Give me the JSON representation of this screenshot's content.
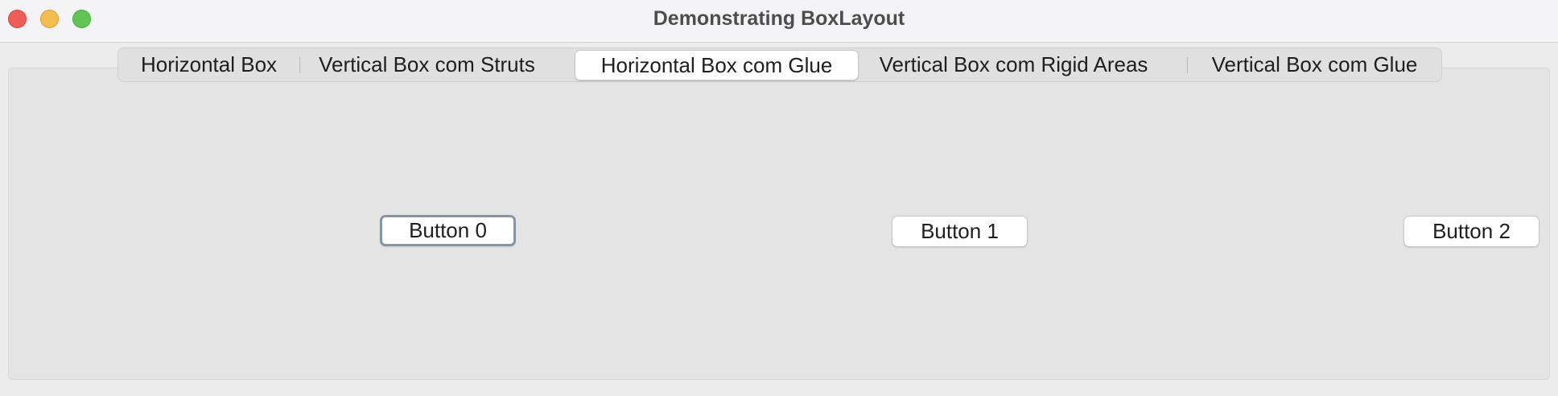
{
  "window": {
    "title": "Demonstrating BoxLayout"
  },
  "tabs": [
    {
      "label": "Horizontal Box",
      "selected": false
    },
    {
      "label": "Vertical Box com Struts",
      "selected": false
    },
    {
      "label": "Horizontal Box com Glue",
      "selected": true
    },
    {
      "label": "Vertical Box com Rigid Areas",
      "selected": false
    },
    {
      "label": "Vertical Box com Glue",
      "selected": false
    }
  ],
  "buttons": [
    {
      "label": "Button 0",
      "focused": true
    },
    {
      "label": "Button 1",
      "focused": false
    },
    {
      "label": "Button 2",
      "focused": false
    }
  ],
  "colors": {
    "close": "#ee5e56",
    "minimize": "#f5bd4f",
    "maximize": "#61c554",
    "focus_ring": "#8893a3"
  }
}
